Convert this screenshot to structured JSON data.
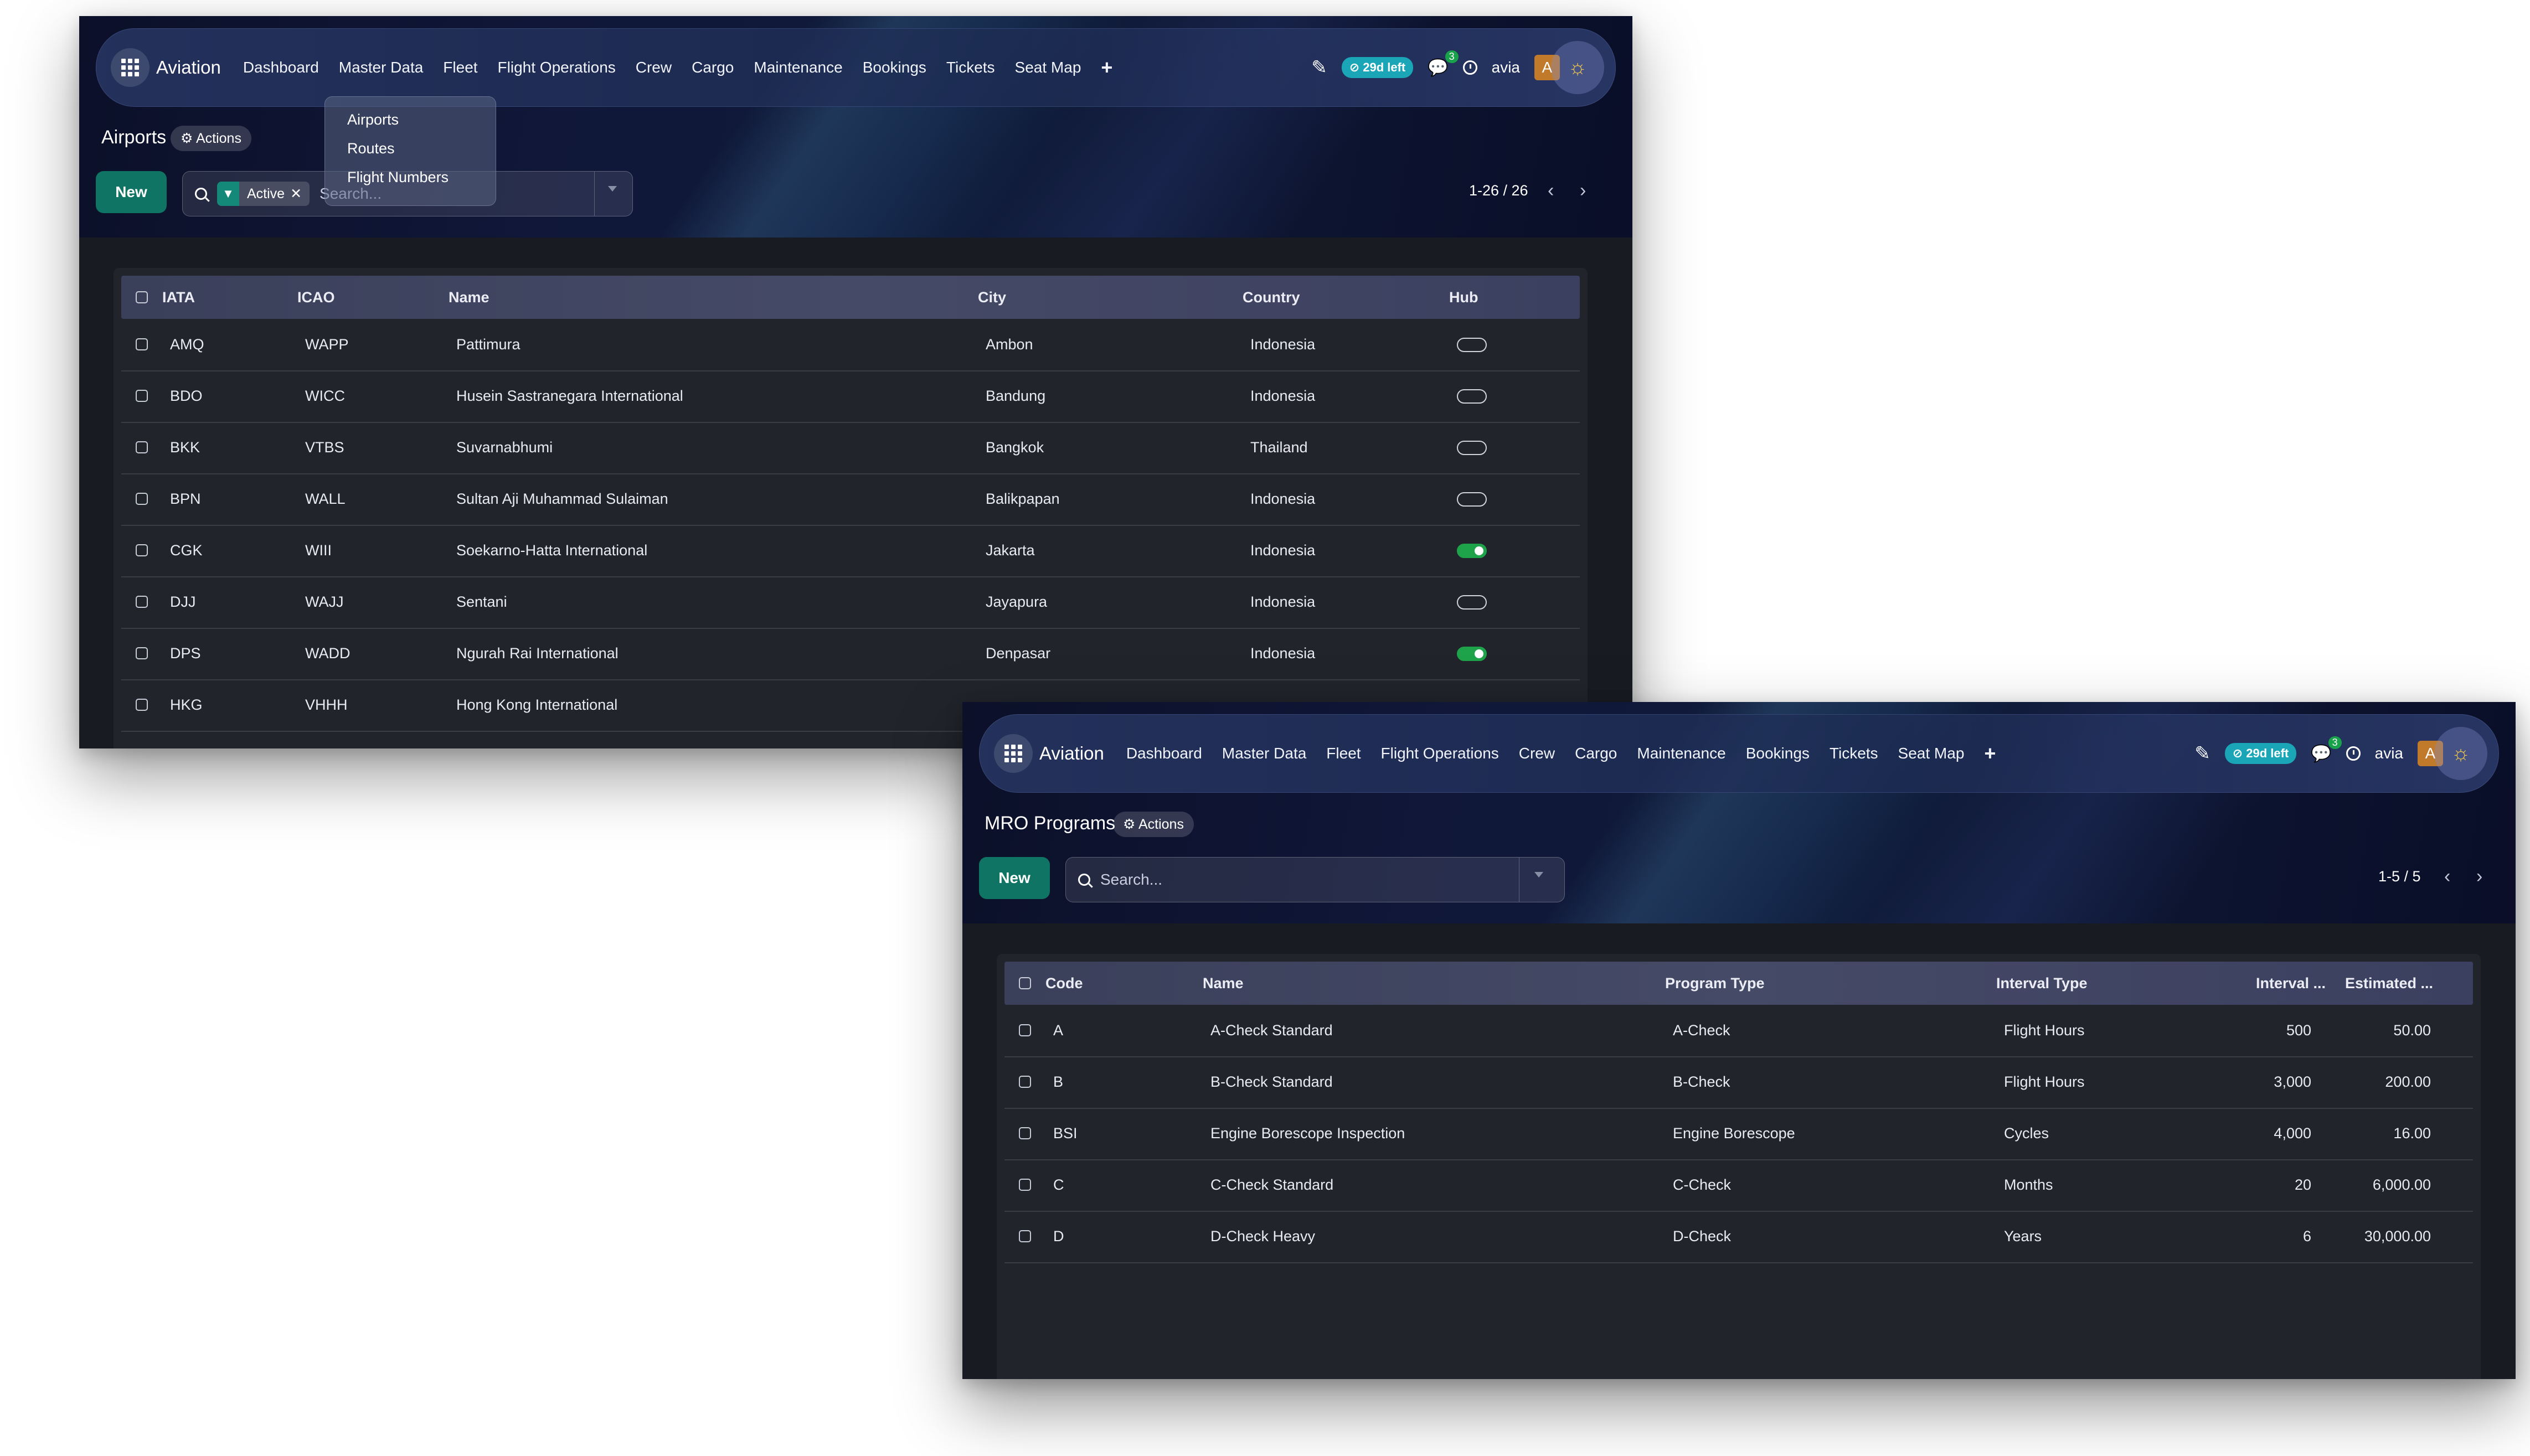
{
  "nav": {
    "brand": "Aviation",
    "menu": [
      "Dashboard",
      "Master Data",
      "Fleet",
      "Flight Operations",
      "Crew",
      "Cargo",
      "Maintenance",
      "Bookings",
      "Tickets",
      "Seat Map"
    ],
    "add_symbol": "+",
    "trial_badge": "⊘ 29d left",
    "messages_count": "3",
    "user": "avia",
    "avatar_letter": "A"
  },
  "airports_view": {
    "title": "Airports",
    "actions_label": "⚙ Actions",
    "new_label": "New",
    "filter_facet": "Active",
    "search_placeholder": "Search...",
    "pager": "1-26 / 26",
    "master_data_dropdown": [
      "Airports",
      "Routes",
      "Flight Numbers"
    ],
    "columns": [
      "IATA",
      "ICAO",
      "Name",
      "City",
      "Country",
      "Hub"
    ],
    "rows": [
      {
        "iata": "AMQ",
        "icao": "WAPP",
        "name": "Pattimura",
        "city": "Ambon",
        "country": "Indonesia",
        "hub": false
      },
      {
        "iata": "BDO",
        "icao": "WICC",
        "name": "Husein Sastranegara International",
        "city": "Bandung",
        "country": "Indonesia",
        "hub": false
      },
      {
        "iata": "BKK",
        "icao": "VTBS",
        "name": "Suvarnabhumi",
        "city": "Bangkok",
        "country": "Thailand",
        "hub": false
      },
      {
        "iata": "BPN",
        "icao": "WALL",
        "name": "Sultan Aji Muhammad Sulaiman",
        "city": "Balikpapan",
        "country": "Indonesia",
        "hub": false
      },
      {
        "iata": "CGK",
        "icao": "WIII",
        "name": "Soekarno-Hatta International",
        "city": "Jakarta",
        "country": "Indonesia",
        "hub": true
      },
      {
        "iata": "DJJ",
        "icao": "WAJJ",
        "name": "Sentani",
        "city": "Jayapura",
        "country": "Indonesia",
        "hub": false
      },
      {
        "iata": "DPS",
        "icao": "WADD",
        "name": "Ngurah Rai International",
        "city": "Denpasar",
        "country": "Indonesia",
        "hub": true
      },
      {
        "iata": "HKG",
        "icao": "VHHH",
        "name": "Hong Kong International",
        "city": "",
        "country": "",
        "hub": false
      }
    ]
  },
  "mro_view": {
    "title": "MRO Programs",
    "actions_label": "⚙ Actions",
    "new_label": "New",
    "search_placeholder": "Search...",
    "pager": "1-5 / 5",
    "columns": [
      "Code",
      "Name",
      "Program Type",
      "Interval Type",
      "Interval ...",
      "Estimated ..."
    ],
    "rows": [
      {
        "code": "A",
        "name": "A-Check Standard",
        "program_type": "A-Check",
        "interval_type": "Flight Hours",
        "interval": "500",
        "estimated": "50.00"
      },
      {
        "code": "B",
        "name": "B-Check Standard",
        "program_type": "B-Check",
        "interval_type": "Flight Hours",
        "interval": "3,000",
        "estimated": "200.00"
      },
      {
        "code": "BSI",
        "name": "Engine Borescope Inspection",
        "program_type": "Engine Borescope",
        "interval_type": "Cycles",
        "interval": "4,000",
        "estimated": "16.00"
      },
      {
        "code": "C",
        "name": "C-Check Standard",
        "program_type": "C-Check",
        "interval_type": "Months",
        "interval": "20",
        "estimated": "6,000.00"
      },
      {
        "code": "D",
        "name": "D-Check Heavy",
        "program_type": "D-Check",
        "interval_type": "Years",
        "interval": "6",
        "estimated": "30,000.00"
      }
    ]
  },
  "colors": {
    "accent_button": "#0f7463",
    "trial_badge": "#1aa6b7",
    "toggle_on": "#1ea34a",
    "avatar": "#c07a2a",
    "nav_bg": "#10183a"
  }
}
